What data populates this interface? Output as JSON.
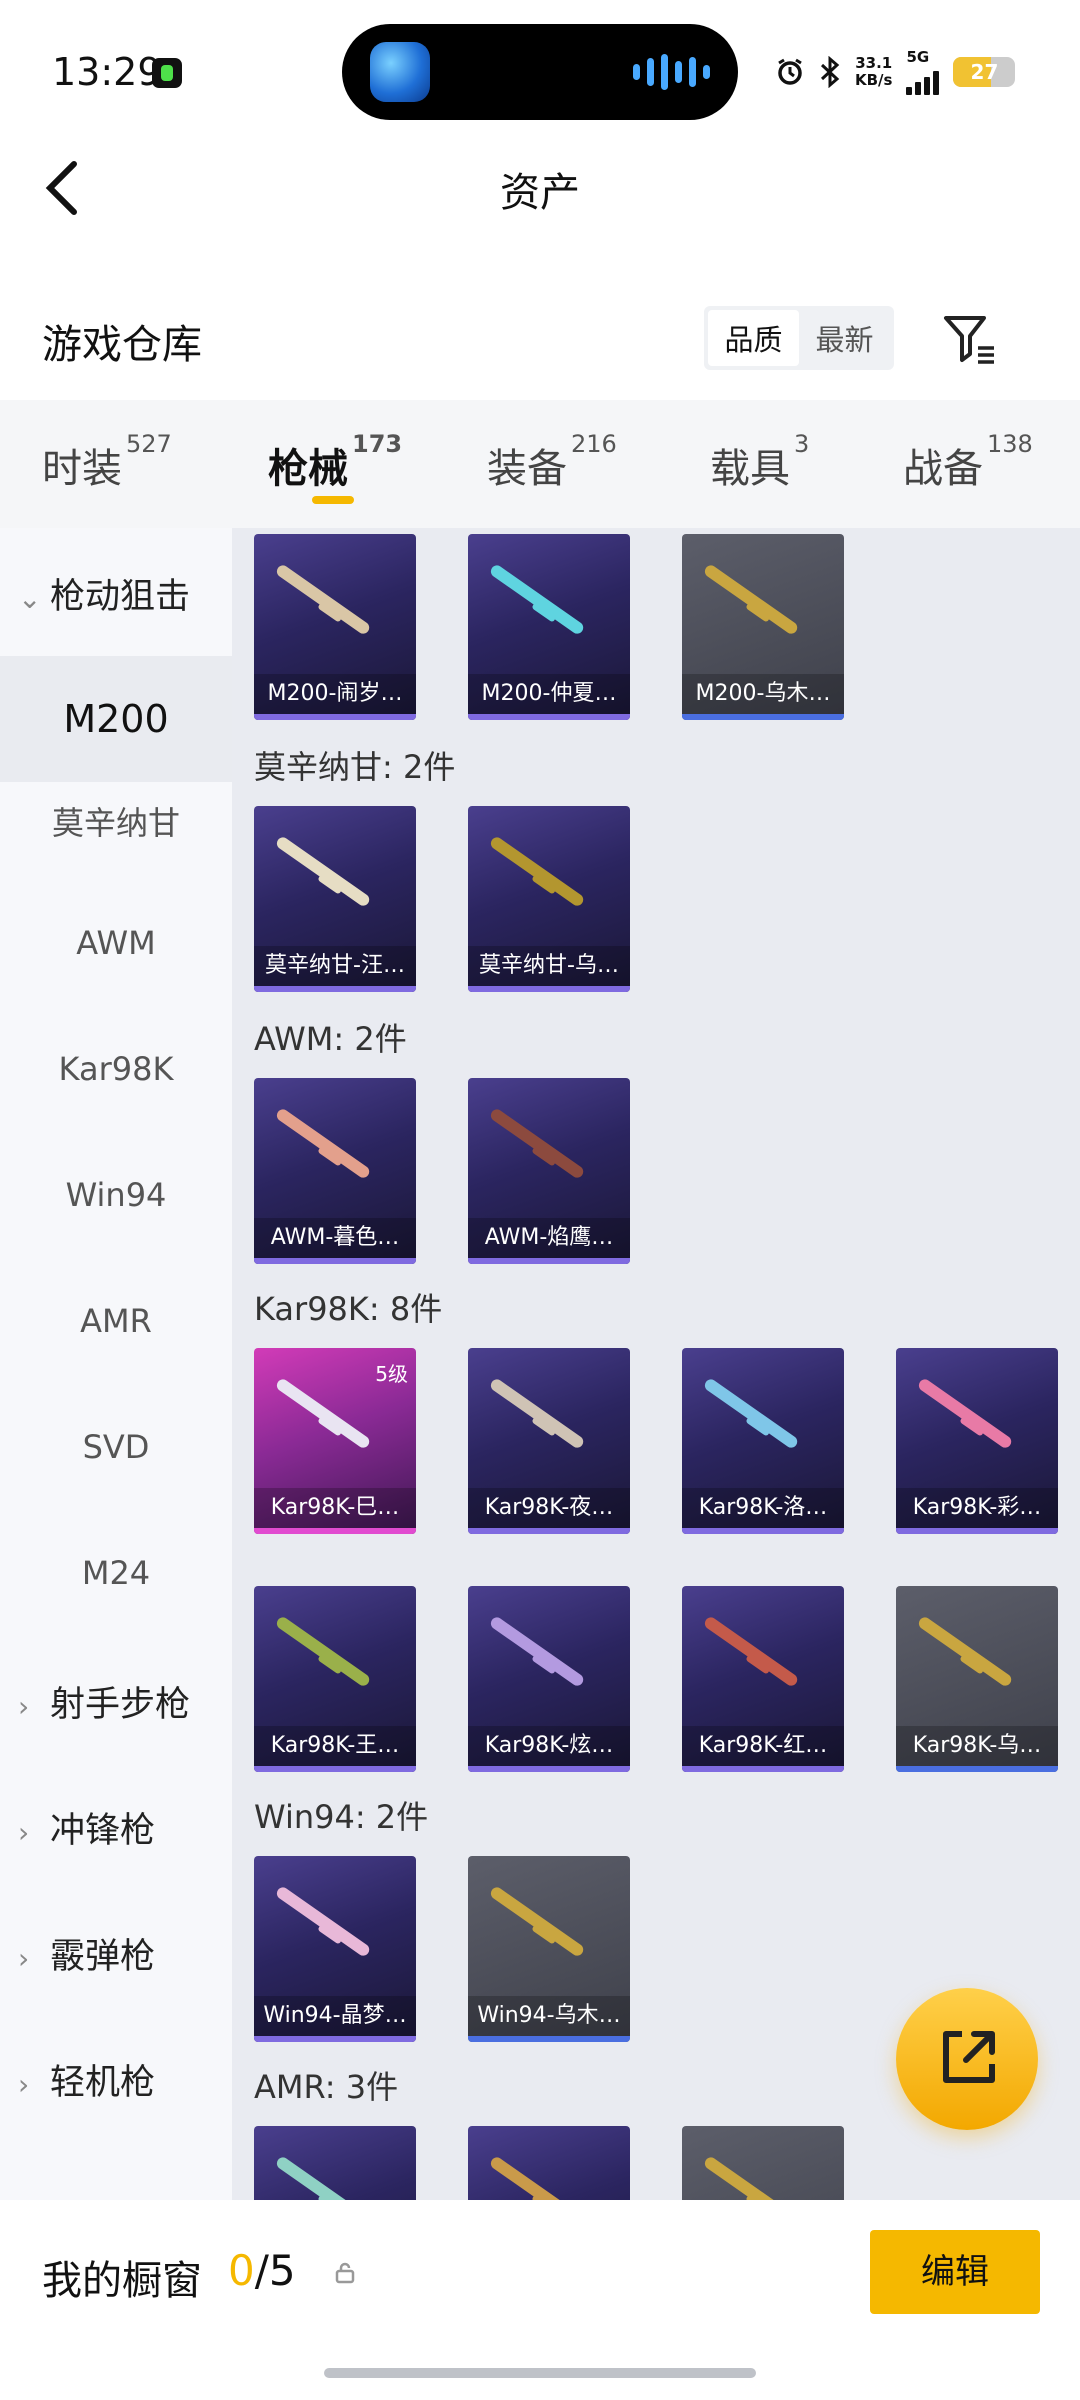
{
  "status": {
    "time": "13:29",
    "net_speed_value": "33.1",
    "net_speed_unit": "KB/s",
    "network": "5G",
    "battery": "27"
  },
  "header": {
    "title": "资产"
  },
  "warehouse": {
    "title": "游戏仓库",
    "sort_quality": "品质",
    "sort_newest": "最新"
  },
  "tabs": [
    {
      "label": "时装",
      "count": "527"
    },
    {
      "label": "枪械",
      "count": "173"
    },
    {
      "label": "装备",
      "count": "216"
    },
    {
      "label": "载具",
      "count": "3"
    },
    {
      "label": "战备",
      "count": "138"
    }
  ],
  "sidebar": {
    "group_open": "枪动狙击",
    "subs": [
      "M200",
      "莫辛纳甘",
      "AWM",
      "Kar98K",
      "Win94",
      "AMR",
      "SVD",
      "M24"
    ],
    "groups_closed": [
      "射手步枪",
      "冲锋枪",
      "霰弹枪",
      "轻机枪"
    ]
  },
  "content": {
    "m200_items": [
      "M200-闹岁…",
      "M200-仲夏…",
      "M200-乌木…"
    ],
    "mosin_header": "莫辛纳甘: 2件",
    "mosin_items": [
      "莫辛纳甘-汪…",
      "莫辛纳甘-乌…"
    ],
    "awm_header": "AWM: 2件",
    "awm_items": [
      "AWM-暮色…",
      "AWM-焰鹰…"
    ],
    "kar_header": "Kar98K: 8件",
    "kar_items": [
      "Kar98K-巳…",
      "Kar98K-夜…",
      "Kar98K-洛…",
      "Kar98K-彩…",
      "Kar98K-王…",
      "Kar98K-炫…",
      "Kar98K-红…",
      "Kar98K-乌…"
    ],
    "kar_level": "5级",
    "win_header": "Win94: 2件",
    "win_items": [
      "Win94-晶梦…",
      "Win94-乌木…"
    ],
    "amr_header": "AMR: 3件"
  },
  "bottom": {
    "title": "我的橱窗",
    "count_current": "0",
    "count_total": "/5",
    "edit_label": "编辑"
  },
  "colors": {
    "accent": "#f5b800",
    "card_purple": "#2b2560",
    "card_gray": "#4a4c56",
    "card_pink": "#b02fa6"
  }
}
